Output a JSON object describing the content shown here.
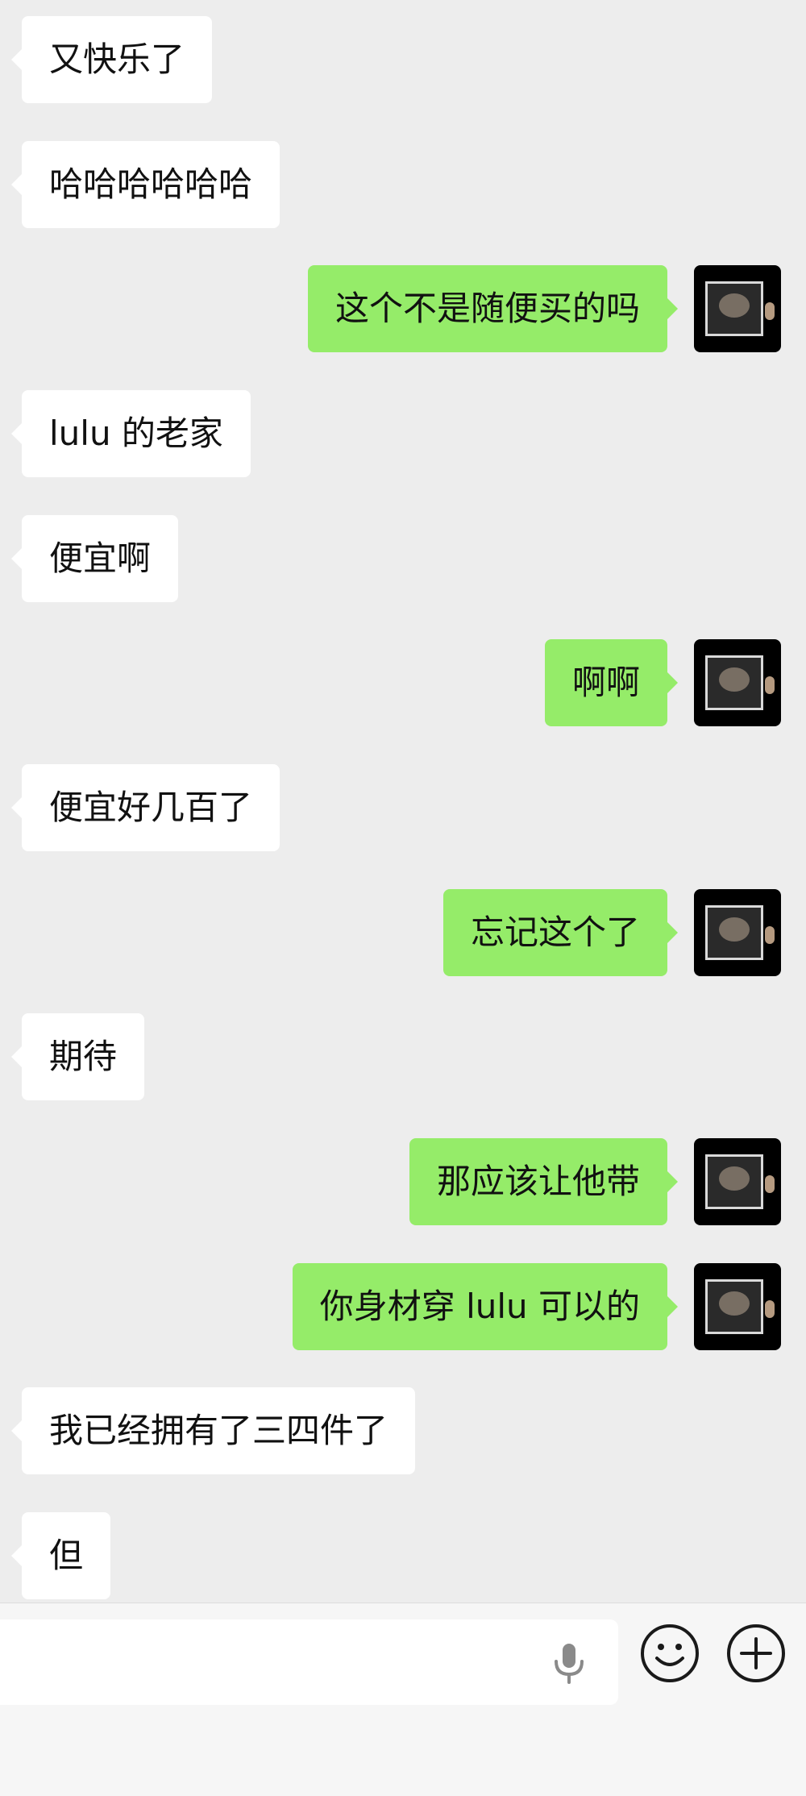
{
  "messages": [
    {
      "side": "in",
      "text": "又快乐了"
    },
    {
      "side": "in",
      "text": "哈哈哈哈哈哈"
    },
    {
      "side": "out",
      "text": "这个不是随便买的吗"
    },
    {
      "side": "in",
      "text": "lulu 的老家"
    },
    {
      "side": "in",
      "text": "便宜啊"
    },
    {
      "side": "out",
      "text": "啊啊"
    },
    {
      "side": "in",
      "text": "便宜好几百了"
    },
    {
      "side": "out",
      "text": "忘记这个了"
    },
    {
      "side": "in",
      "text": "期待"
    },
    {
      "side": "out",
      "text": "那应该让他带"
    },
    {
      "side": "out",
      "text": "你身材穿 lulu 可以的"
    },
    {
      "side": "in",
      "text": "我已经拥有了三四件了"
    },
    {
      "side": "in",
      "text": "但"
    }
  ],
  "colors": {
    "incoming_bubble": "#ffffff",
    "outgoing_bubble": "#95ec69",
    "background": "#ededed"
  },
  "icons": {
    "voice": "microphone-icon",
    "emoji": "smiley-icon",
    "more": "plus-circle-icon",
    "avatar": "framed-picture-avatar"
  }
}
